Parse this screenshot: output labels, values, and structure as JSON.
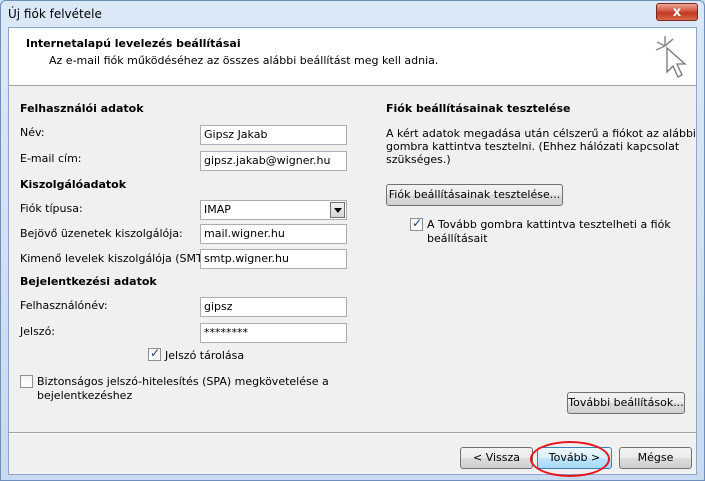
{
  "window": {
    "title": "Új fiók felvétele",
    "close_glyph": "x"
  },
  "header": {
    "title": "Internetalapú levelezés beállításai",
    "subtitle": "Az e-mail fiók működéséhez az összes alábbi beállítást meg kell adnia.",
    "icon": "wizard-cursor-icon"
  },
  "user_info": {
    "heading": "Felhasználói adatok",
    "name_label": "Név:",
    "name_value": "Gipsz Jakab",
    "email_label": "E-mail cím:",
    "email_value": "gipsz.jakab@wigner.hu"
  },
  "server_info": {
    "heading": "Kiszolgálóadatok",
    "account_type_label": "Fiók típusa:",
    "account_type_value": "IMAP",
    "incoming_label": "Bejövő üzenetek kiszolgálója:",
    "incoming_value": "mail.wigner.hu",
    "outgoing_label": "Kimenő levelek kiszolgálója (SMTP):",
    "outgoing_value": "smtp.wigner.hu"
  },
  "login_info": {
    "heading": "Bejelentkezési adatok",
    "username_label": "Felhasználónév:",
    "username_value": "gipsz",
    "password_label": "Jelszó:",
    "password_value": "********",
    "remember_label": "Jelszó tárolása",
    "remember_checked": true,
    "spa_label_line1": "Biztonságos jelszó-hitelesítés (SPA) megkövetelése a",
    "spa_label_line2": "bejelentkezéshez",
    "spa_checked": false
  },
  "test_settings": {
    "heading": "Fiók beállításainak tesztelése",
    "desc_line1": "A kért adatok megadása után célszerű a fiókot az alábbi",
    "desc_line2": "gombra kattintva tesztelni. (Ehhez hálózati kapcsolat",
    "desc_line3": "szükséges.)",
    "test_button": "Fiók beállításainak tesztelése...",
    "auto_test_line1": "A Tovább gombra kattintva tesztelheti a fiók",
    "auto_test_line2": "beállításait",
    "auto_test_checked": true,
    "more_settings_button": "További beállítások..."
  },
  "footer": {
    "back_button": "< Vissza",
    "next_button": "Tovább >",
    "cancel_button": "Mégse",
    "highlight_color": "#e8141c"
  }
}
